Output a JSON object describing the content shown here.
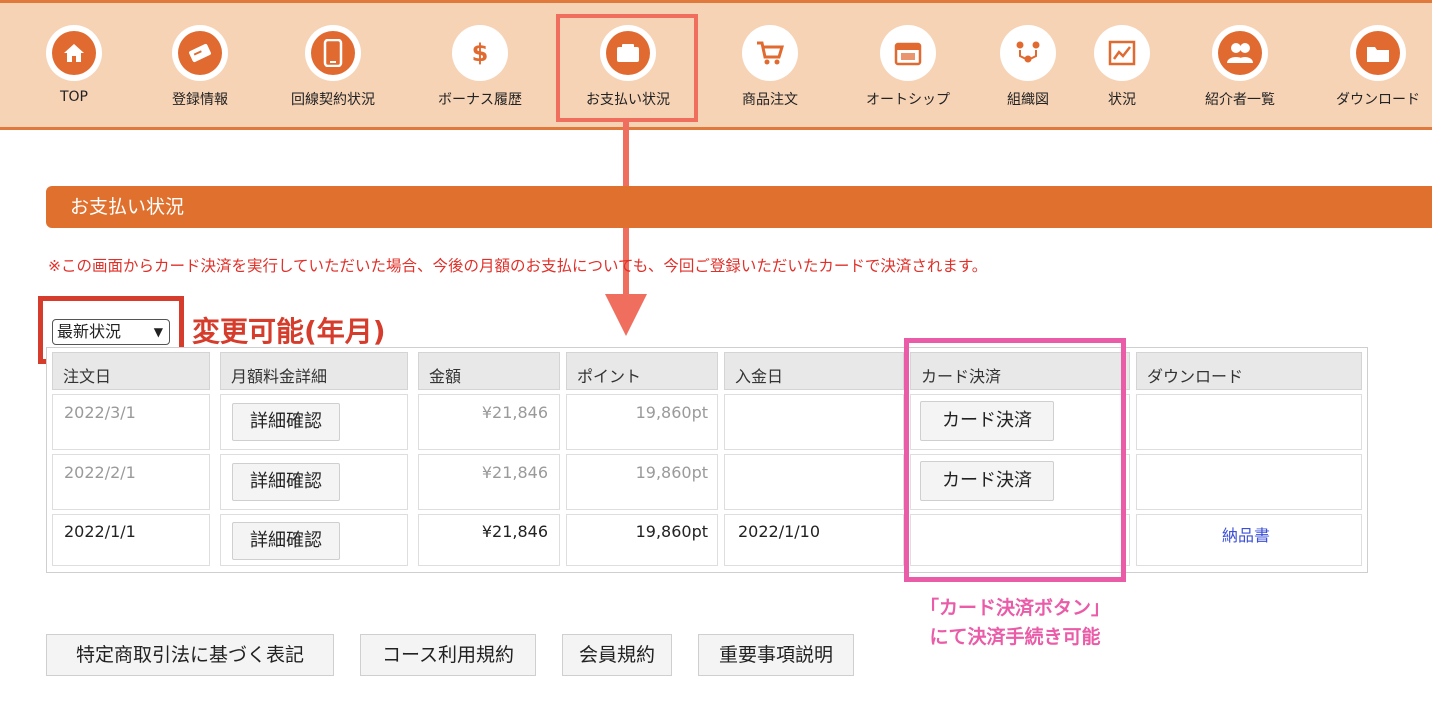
{
  "nav": {
    "items": [
      {
        "label": "TOP",
        "icon": "home-icon"
      },
      {
        "label": "登録情報",
        "icon": "id-card-icon"
      },
      {
        "label": "回線契約状況",
        "icon": "smartphone-icon"
      },
      {
        "label": "ボーナス履歴",
        "icon": "dollar-icon"
      },
      {
        "label": "お支払い状況",
        "icon": "wallet-icon"
      },
      {
        "label": "商品注文",
        "icon": "cart-icon"
      },
      {
        "label": "オートシップ",
        "icon": "calendar-icon"
      },
      {
        "label": "組織図",
        "icon": "org-chart-icon"
      },
      {
        "label": "状況",
        "icon": "chart-icon"
      },
      {
        "label": "紹介者一覧",
        "icon": "users-icon"
      },
      {
        "label": "ダウンロード",
        "icon": "folder-icon"
      }
    ],
    "active_index": 4
  },
  "section": {
    "title": "お支払い状況",
    "notice": "※この画面からカード決済を実行していただいた場合、今後の月額のお支払についても、今回ご登録いただいたカードで決済されます。"
  },
  "period_select": {
    "value": "最新状況"
  },
  "annotations": {
    "change_note": "変更可能(年月)",
    "card_note_line1": "「カード決済ボタン」",
    "card_note_line2": "にて決済手続き可能"
  },
  "table": {
    "headers": [
      "注文日",
      "月額料金詳細",
      "金額",
      "ポイント",
      "入金日",
      "カード決済",
      "ダウンロード"
    ],
    "rows": [
      {
        "date": "2022/3/1",
        "detail": "詳細確認",
        "amount": "¥21,846",
        "points": "19,860pt",
        "paid_date": "",
        "card": "カード決済",
        "download": ""
      },
      {
        "date": "2022/2/1",
        "detail": "詳細確認",
        "amount": "¥21,846",
        "points": "19,860pt",
        "paid_date": "",
        "card": "カード決済",
        "download": ""
      },
      {
        "date": "2022/1/1",
        "detail": "詳細確認",
        "amount": "¥21,846",
        "points": "19,860pt",
        "paid_date": "2022/1/10",
        "card": "",
        "download": "納品書"
      }
    ]
  },
  "footer": {
    "links": [
      "特定商取引法に基づく表記",
      "コース利用規約",
      "会員規約",
      "重要事項説明"
    ]
  },
  "colors": {
    "accent": "#e0702e",
    "nav_bg": "#f7d3b6",
    "highlight_red": "#d63c2c",
    "highlight_pink": "#ea5ca8"
  }
}
